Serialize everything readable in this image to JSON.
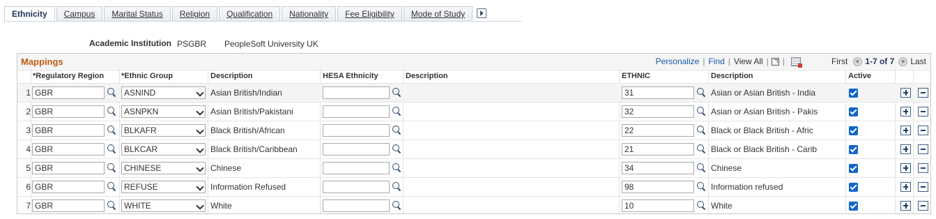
{
  "tabs": [
    {
      "label": "Ethnicity",
      "active": true
    },
    {
      "label": "Campus",
      "active": false
    },
    {
      "label": "Marital Status",
      "active": false
    },
    {
      "label": "Religion",
      "active": false
    },
    {
      "label": "Qualification",
      "active": false
    },
    {
      "label": "Nationality",
      "active": false
    },
    {
      "label": "Fee Eligibility",
      "active": false
    },
    {
      "label": "Mode of Study",
      "active": false
    }
  ],
  "institution": {
    "label": "Academic Institution",
    "code": "PSGBR",
    "description": "PeopleSoft University UK"
  },
  "grid": {
    "title": "Mappings",
    "personalize": "Personalize",
    "find": "Find",
    "view_all": "View All",
    "first": "First",
    "count": "1-7 of 7",
    "last": "Last",
    "columns": {
      "region": "*Regulatory Region",
      "ethnic_group": "*Ethnic Group",
      "description": "Description",
      "hesa": "HESA Ethnicity",
      "hesa_description": "Description",
      "ethnic": "ETHNIC",
      "ethnic_description": "Description",
      "active": "Active"
    },
    "rows": [
      {
        "num": "1",
        "region": "GBR",
        "group": "ASNIND",
        "description": "Asian British/Indian",
        "hesa": "",
        "hesa_desc": "",
        "ethnic": "31",
        "ethnic_desc": "Asian or Asian British - India",
        "active": true
      },
      {
        "num": "2",
        "region": "GBR",
        "group": "ASNPKN",
        "description": "Asian British/Pakistani",
        "hesa": "",
        "hesa_desc": "",
        "ethnic": "32",
        "ethnic_desc": "Asian or Asian British - Pakis",
        "active": true
      },
      {
        "num": "3",
        "region": "GBR",
        "group": "BLKAFR",
        "description": "Black British/African",
        "hesa": "",
        "hesa_desc": "",
        "ethnic": "22",
        "ethnic_desc": "Black or Black British - Afric",
        "active": true
      },
      {
        "num": "4",
        "region": "GBR",
        "group": "BLKCAR",
        "description": "Black British/Caribbean",
        "hesa": "",
        "hesa_desc": "",
        "ethnic": "21",
        "ethnic_desc": "Black or Black British - Carib",
        "active": true
      },
      {
        "num": "5",
        "region": "GBR",
        "group": "CHINESE",
        "description": "Chinese",
        "hesa": "",
        "hesa_desc": "",
        "ethnic": "34",
        "ethnic_desc": "Chinese",
        "active": true
      },
      {
        "num": "6",
        "region": "GBR",
        "group": "REFUSE",
        "description": "Information Refused",
        "hesa": "",
        "hesa_desc": "",
        "ethnic": "98",
        "ethnic_desc": "Information refused",
        "active": true
      },
      {
        "num": "7",
        "region": "GBR",
        "group": "WHITE",
        "description": "White",
        "hesa": "",
        "hesa_desc": "",
        "ethnic": "10",
        "ethnic_desc": "White",
        "active": true
      }
    ]
  }
}
